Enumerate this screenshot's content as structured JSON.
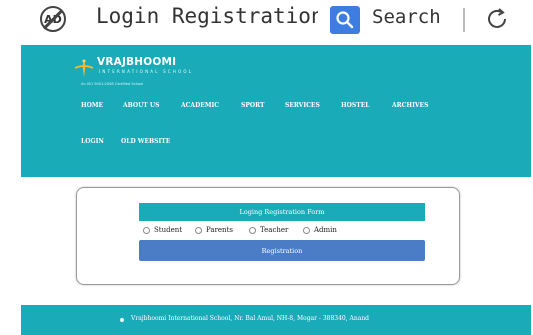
{
  "browser": {
    "title": "Login Registration F",
    "search_label": "Search",
    "ad_icon": "AD"
  },
  "header": {
    "logo": {
      "name": "VRAJBHOOMI",
      "subtitle": "INTERNATIONAL SCHOOL",
      "tagline": "An ISO 9001:2008 Certified School"
    },
    "nav": [
      {
        "label": "HOME"
      },
      {
        "label": "ABOUT US"
      },
      {
        "label": "ACADEMIC"
      },
      {
        "label": "SPORT"
      },
      {
        "label": "SERVICES"
      },
      {
        "label": "HOSTEL"
      },
      {
        "label": "ARCHIVES"
      },
      {
        "label": "LOGIN"
      },
      {
        "label": "OLD WEBSITE"
      }
    ]
  },
  "form": {
    "title": "Loging Registration Form",
    "roles": [
      {
        "label": "Student"
      },
      {
        "label": "Parents"
      },
      {
        "label": "Teacher"
      },
      {
        "label": "Admin"
      }
    ],
    "register_label": "Registration"
  },
  "footer": {
    "address": "Vrajbhoomi International School, Nr. Bal Amul, NH-8, Mogar - 388340, Anand"
  },
  "colors": {
    "teal": "#1aabb8",
    "button_blue": "#4a7dc6",
    "search_blue": "#3d7de0"
  }
}
